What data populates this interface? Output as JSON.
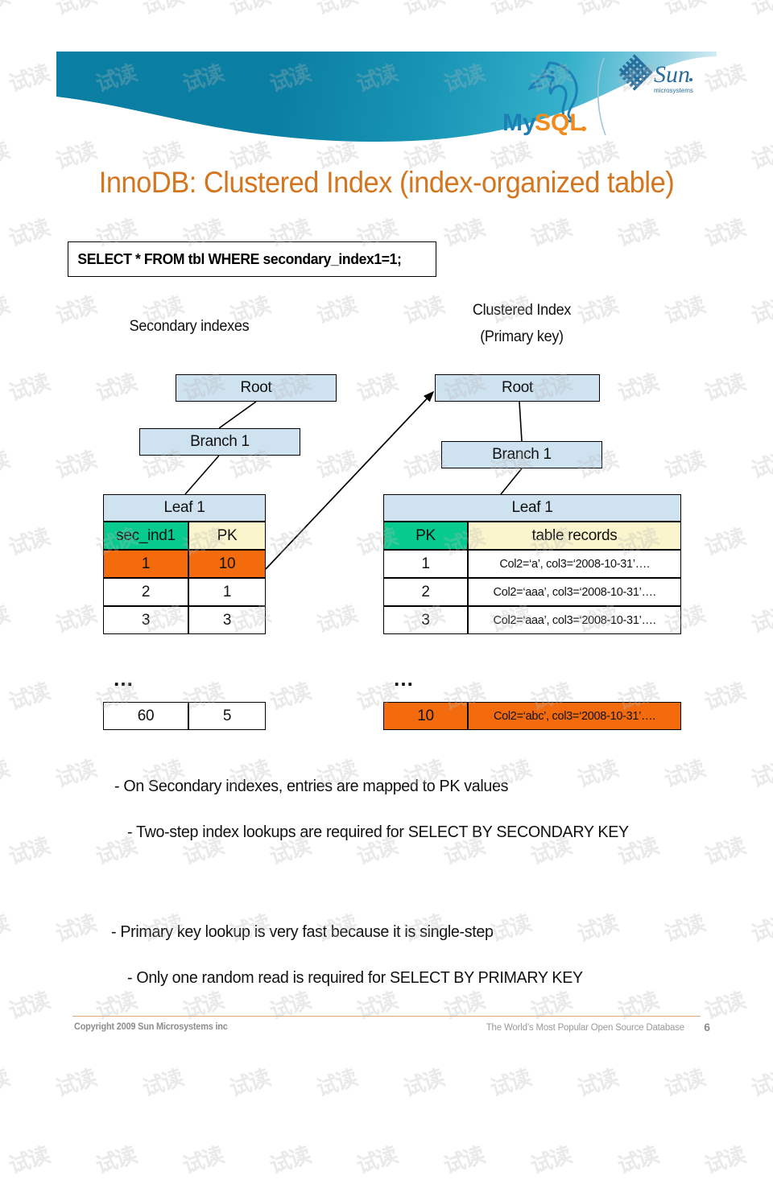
{
  "header": {
    "logo_mysql": "mysql-dolphin-logo",
    "logo_mysql_text_my": "My",
    "logo_mysql_text_sql": "SQL",
    "logo_sun": "sun-microsystems-logo",
    "logo_sun_text": "Sun",
    "logo_sun_sub": "microsystems",
    "banner_color_start": "#0b7fa3",
    "banner_color_end": "#eaf5f9"
  },
  "title": "InnoDB: Clustered Index (index-organized table)",
  "title_color": "#d4761f",
  "sql": {
    "query": "SELECT * FROM tbl WHERE secondary_index1=1;"
  },
  "diagram": {
    "left": {
      "caption": "Secondary indexes",
      "root": "Root",
      "branch": "Branch 1",
      "leaf": "Leaf 1",
      "columns": [
        "sec_ind1",
        "PK"
      ],
      "rows": [
        {
          "sec_ind1": "1",
          "pk": "10",
          "highlight": true
        },
        {
          "sec_ind1": "2",
          "pk": "1",
          "highlight": false
        },
        {
          "sec_ind1": "3",
          "pk": "3",
          "highlight": false
        }
      ],
      "ellipsis": "…",
      "last_row": {
        "sec_ind1": "60",
        "pk": "5"
      }
    },
    "right": {
      "caption_line1": "Clustered Index",
      "caption_line2": "(Primary key)",
      "root": "Root",
      "branch": "Branch 1",
      "leaf": "Leaf 1",
      "columns": [
        "PK",
        "table records"
      ],
      "rows": [
        {
          "pk": "1",
          "record": "Col2=‘a’, col3=‘2008-10-31’….",
          "highlight": false
        },
        {
          "pk": "2",
          "record": "Col2=‘aaa’, col3=‘2008-10-31’….",
          "highlight": false
        },
        {
          "pk": "3",
          "record": "Col2=‘aaa’, col3=‘2008-10-31’….",
          "highlight": false
        }
      ],
      "ellipsis": "…",
      "last_row": {
        "pk": "10",
        "record": "Col2=‘abc’, col3=‘2008-10-31’…."
      }
    },
    "colors": {
      "node_fill": "#cfe2f0",
      "header_green": "#07cb8e",
      "header_yellow": "#fbf5cd",
      "highlight_orange": "#f36b0d"
    }
  },
  "bullets": [
    "- On Secondary indexes, entries are mapped to PK values",
    "- Two-step index lookups are required for SELECT BY SECONDARY KEY",
    "- Primary key lookup is very fast because it is single-step",
    "- Only one random read is required for SELECT BY PRIMARY KEY"
  ],
  "footer": {
    "copyright": "Copyright 2009 Sun Microsystems inc",
    "tagline": "The World’s Most Popular Open Source Database",
    "page_number": "6"
  },
  "watermark": {
    "text": "试读"
  }
}
